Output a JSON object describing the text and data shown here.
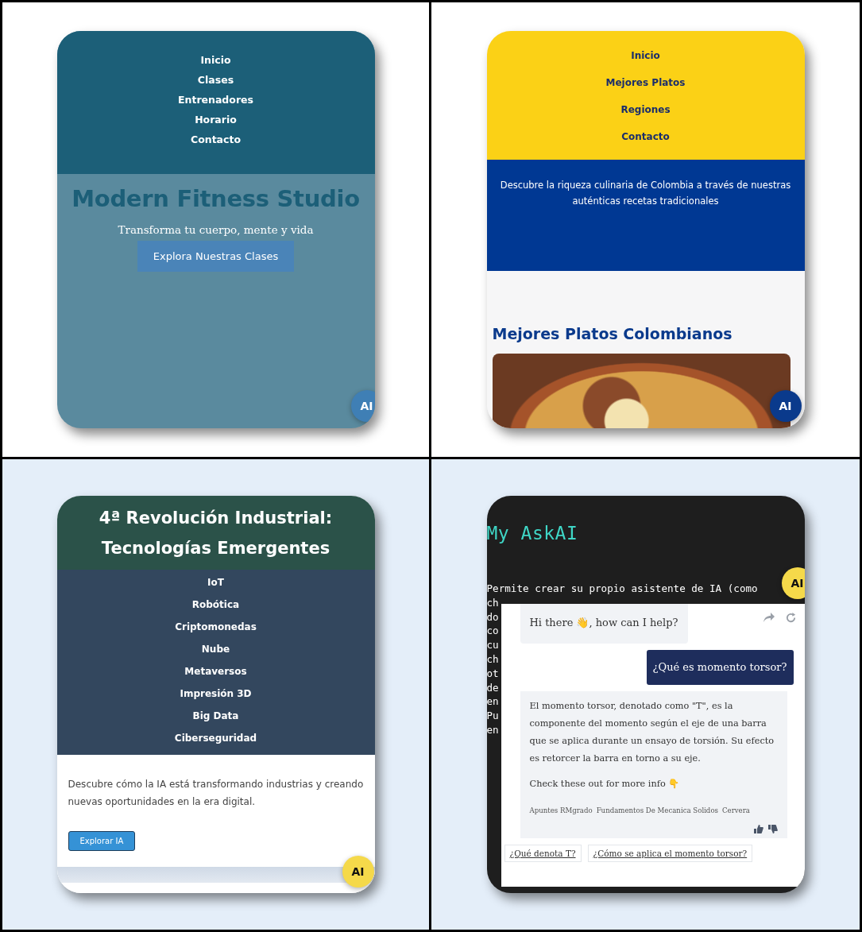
{
  "panels": [
    {
      "kind": "fitness",
      "nav": [
        {
          "label": "Inicio"
        },
        {
          "label": "Clases"
        },
        {
          "label": "Entrenadores"
        },
        {
          "label": "Horario"
        },
        {
          "label": "Contacto"
        }
      ],
      "title": "Modern Fitness Studio",
      "subtitle": "Transforma tu cuerpo, mente y vida",
      "button": "Explora Nuestras Clases",
      "ai_button": "AI"
    },
    {
      "kind": "food",
      "nav": [
        {
          "label": "Inicio"
        },
        {
          "label": "Mejores Platos"
        },
        {
          "label": "Regiones"
        },
        {
          "label": "Contacto"
        }
      ],
      "intro": "Descubre la riqueza culinaria de Colombia a través de nuestras auténticas recetas tradicionales",
      "heading": "Mejores Platos Colombianos",
      "ai_button": "AI"
    },
    {
      "kind": "tech",
      "title": "4ª Revolución Industrial: Tecnologías Emergentes",
      "nav": [
        {
          "label": "IoT"
        },
        {
          "label": "Robótica"
        },
        {
          "label": "Criptomonedas"
        },
        {
          "label": "Nube"
        },
        {
          "label": "Metaversos"
        },
        {
          "label": "Impresión 3D"
        },
        {
          "label": "Big Data"
        },
        {
          "label": "Ciberseguridad"
        }
      ],
      "paragraph": "Descubre cómo la IA está transformando industrias y creando nuevas oportunidades en la era digital.",
      "button": "Explorar IA",
      "ai_button": "AI"
    },
    {
      "kind": "askai",
      "title": "My AskAI",
      "first_line": "Permite crear su propio asistente de IA (como",
      "line_starts": [
        "ch",
        "do",
        "co",
        "cu",
        "ch",
        "ot",
        "de",
        "en",
        "Pu",
        "en"
      ],
      "ai_button": "AI",
      "chat": {
        "messages": [
          {
            "kind": "bot",
            "text": "Hi there 👋, how can I help?"
          },
          {
            "kind": "user",
            "text": "¿Qué es momento torsor?"
          },
          {
            "kind": "answer",
            "text": "El momento torsor, denotado como \"T\", es la componente del momento según el eje de una barra que se aplica durante un ensayo de torsión. Su efecto es retorcer la barra en torno a su eje.",
            "more": "Check these out for more info 👇",
            "sources": [
              "Apuntes RMgrado",
              "Fundamentos De Mecanica Solidos",
              "Cervera"
            ]
          }
        ],
        "suggestions": [
          "¿Qué denota T?",
          "¿Cómo se aplica el momento torsor?"
        ]
      }
    }
  ]
}
